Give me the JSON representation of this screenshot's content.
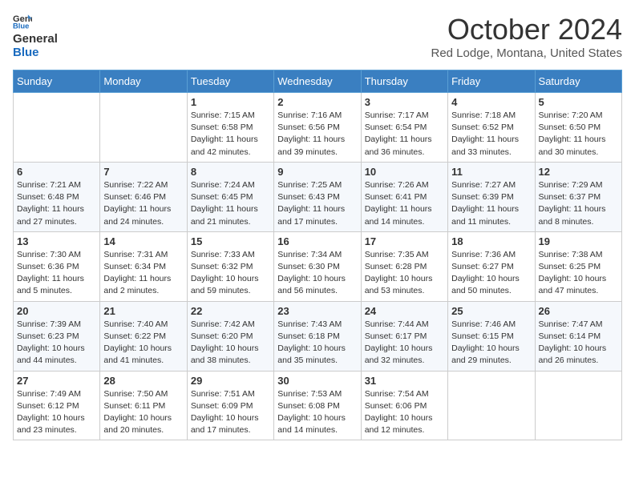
{
  "header": {
    "logo_line1": "General",
    "logo_line2": "Blue",
    "month_title": "October 2024",
    "location": "Red Lodge, Montana, United States"
  },
  "weekdays": [
    "Sunday",
    "Monday",
    "Tuesday",
    "Wednesday",
    "Thursday",
    "Friday",
    "Saturday"
  ],
  "weeks": [
    [
      {
        "day": "",
        "sunrise": "",
        "sunset": "",
        "daylight": ""
      },
      {
        "day": "",
        "sunrise": "",
        "sunset": "",
        "daylight": ""
      },
      {
        "day": "1",
        "sunrise": "Sunrise: 7:15 AM",
        "sunset": "Sunset: 6:58 PM",
        "daylight": "Daylight: 11 hours and 42 minutes."
      },
      {
        "day": "2",
        "sunrise": "Sunrise: 7:16 AM",
        "sunset": "Sunset: 6:56 PM",
        "daylight": "Daylight: 11 hours and 39 minutes."
      },
      {
        "day": "3",
        "sunrise": "Sunrise: 7:17 AM",
        "sunset": "Sunset: 6:54 PM",
        "daylight": "Daylight: 11 hours and 36 minutes."
      },
      {
        "day": "4",
        "sunrise": "Sunrise: 7:18 AM",
        "sunset": "Sunset: 6:52 PM",
        "daylight": "Daylight: 11 hours and 33 minutes."
      },
      {
        "day": "5",
        "sunrise": "Sunrise: 7:20 AM",
        "sunset": "Sunset: 6:50 PM",
        "daylight": "Daylight: 11 hours and 30 minutes."
      }
    ],
    [
      {
        "day": "6",
        "sunrise": "Sunrise: 7:21 AM",
        "sunset": "Sunset: 6:48 PM",
        "daylight": "Daylight: 11 hours and 27 minutes."
      },
      {
        "day": "7",
        "sunrise": "Sunrise: 7:22 AM",
        "sunset": "Sunset: 6:46 PM",
        "daylight": "Daylight: 11 hours and 24 minutes."
      },
      {
        "day": "8",
        "sunrise": "Sunrise: 7:24 AM",
        "sunset": "Sunset: 6:45 PM",
        "daylight": "Daylight: 11 hours and 21 minutes."
      },
      {
        "day": "9",
        "sunrise": "Sunrise: 7:25 AM",
        "sunset": "Sunset: 6:43 PM",
        "daylight": "Daylight: 11 hours and 17 minutes."
      },
      {
        "day": "10",
        "sunrise": "Sunrise: 7:26 AM",
        "sunset": "Sunset: 6:41 PM",
        "daylight": "Daylight: 11 hours and 14 minutes."
      },
      {
        "day": "11",
        "sunrise": "Sunrise: 7:27 AM",
        "sunset": "Sunset: 6:39 PM",
        "daylight": "Daylight: 11 hours and 11 minutes."
      },
      {
        "day": "12",
        "sunrise": "Sunrise: 7:29 AM",
        "sunset": "Sunset: 6:37 PM",
        "daylight": "Daylight: 11 hours and 8 minutes."
      }
    ],
    [
      {
        "day": "13",
        "sunrise": "Sunrise: 7:30 AM",
        "sunset": "Sunset: 6:36 PM",
        "daylight": "Daylight: 11 hours and 5 minutes."
      },
      {
        "day": "14",
        "sunrise": "Sunrise: 7:31 AM",
        "sunset": "Sunset: 6:34 PM",
        "daylight": "Daylight: 11 hours and 2 minutes."
      },
      {
        "day": "15",
        "sunrise": "Sunrise: 7:33 AM",
        "sunset": "Sunset: 6:32 PM",
        "daylight": "Daylight: 10 hours and 59 minutes."
      },
      {
        "day": "16",
        "sunrise": "Sunrise: 7:34 AM",
        "sunset": "Sunset: 6:30 PM",
        "daylight": "Daylight: 10 hours and 56 minutes."
      },
      {
        "day": "17",
        "sunrise": "Sunrise: 7:35 AM",
        "sunset": "Sunset: 6:28 PM",
        "daylight": "Daylight: 10 hours and 53 minutes."
      },
      {
        "day": "18",
        "sunrise": "Sunrise: 7:36 AM",
        "sunset": "Sunset: 6:27 PM",
        "daylight": "Daylight: 10 hours and 50 minutes."
      },
      {
        "day": "19",
        "sunrise": "Sunrise: 7:38 AM",
        "sunset": "Sunset: 6:25 PM",
        "daylight": "Daylight: 10 hours and 47 minutes."
      }
    ],
    [
      {
        "day": "20",
        "sunrise": "Sunrise: 7:39 AM",
        "sunset": "Sunset: 6:23 PM",
        "daylight": "Daylight: 10 hours and 44 minutes."
      },
      {
        "day": "21",
        "sunrise": "Sunrise: 7:40 AM",
        "sunset": "Sunset: 6:22 PM",
        "daylight": "Daylight: 10 hours and 41 minutes."
      },
      {
        "day": "22",
        "sunrise": "Sunrise: 7:42 AM",
        "sunset": "Sunset: 6:20 PM",
        "daylight": "Daylight: 10 hours and 38 minutes."
      },
      {
        "day": "23",
        "sunrise": "Sunrise: 7:43 AM",
        "sunset": "Sunset: 6:18 PM",
        "daylight": "Daylight: 10 hours and 35 minutes."
      },
      {
        "day": "24",
        "sunrise": "Sunrise: 7:44 AM",
        "sunset": "Sunset: 6:17 PM",
        "daylight": "Daylight: 10 hours and 32 minutes."
      },
      {
        "day": "25",
        "sunrise": "Sunrise: 7:46 AM",
        "sunset": "Sunset: 6:15 PM",
        "daylight": "Daylight: 10 hours and 29 minutes."
      },
      {
        "day": "26",
        "sunrise": "Sunrise: 7:47 AM",
        "sunset": "Sunset: 6:14 PM",
        "daylight": "Daylight: 10 hours and 26 minutes."
      }
    ],
    [
      {
        "day": "27",
        "sunrise": "Sunrise: 7:49 AM",
        "sunset": "Sunset: 6:12 PM",
        "daylight": "Daylight: 10 hours and 23 minutes."
      },
      {
        "day": "28",
        "sunrise": "Sunrise: 7:50 AM",
        "sunset": "Sunset: 6:11 PM",
        "daylight": "Daylight: 10 hours and 20 minutes."
      },
      {
        "day": "29",
        "sunrise": "Sunrise: 7:51 AM",
        "sunset": "Sunset: 6:09 PM",
        "daylight": "Daylight: 10 hours and 17 minutes."
      },
      {
        "day": "30",
        "sunrise": "Sunrise: 7:53 AM",
        "sunset": "Sunset: 6:08 PM",
        "daylight": "Daylight: 10 hours and 14 minutes."
      },
      {
        "day": "31",
        "sunrise": "Sunrise: 7:54 AM",
        "sunset": "Sunset: 6:06 PM",
        "daylight": "Daylight: 10 hours and 12 minutes."
      },
      {
        "day": "",
        "sunrise": "",
        "sunset": "",
        "daylight": ""
      },
      {
        "day": "",
        "sunrise": "",
        "sunset": "",
        "daylight": ""
      }
    ]
  ]
}
